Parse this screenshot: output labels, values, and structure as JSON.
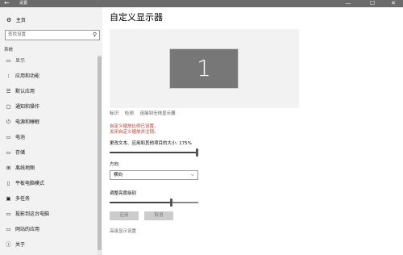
{
  "window": {
    "back_icon": "←",
    "title": "设置",
    "min_icon": "—",
    "max_icon": "☐",
    "close_icon": "✕"
  },
  "sidebar": {
    "home": {
      "icon": "⚙",
      "label": "主页"
    },
    "search": {
      "placeholder": "查找设置",
      "icon": "⚲"
    },
    "section": "系统",
    "items": [
      {
        "icon": "▭",
        "label": "显示",
        "active": true
      },
      {
        "icon": "⁝",
        "label": "应用和功能"
      },
      {
        "icon": "☰",
        "label": "默认应用"
      },
      {
        "icon": "▢",
        "label": "通知和操作"
      },
      {
        "icon": "⏻",
        "label": "电源和睡眠"
      },
      {
        "icon": "▭",
        "label": "电池"
      },
      {
        "icon": "▭",
        "label": "存储"
      },
      {
        "icon": "⊞",
        "label": "离线地图"
      },
      {
        "icon": "▯",
        "label": "平板电脑模式"
      },
      {
        "icon": "▣",
        "label": "多任务"
      },
      {
        "icon": "▭",
        "label": "投影到这台电脑"
      },
      {
        "icon": "▭",
        "label": "网站的应用"
      },
      {
        "icon": "ⓘ",
        "label": "关于"
      }
    ]
  },
  "main": {
    "title": "自定义显示器",
    "monitor_number": "1",
    "links": [
      "标识",
      "检测",
      "连接到无线显示器"
    ],
    "error_line1": "自定义缩放比例已设置。",
    "error_line2": "关闭自定义缩放并注销。",
    "scale_label": "更改文本、应用和其他项目的大小: 175%",
    "scale_percent": 100,
    "orientation_label": "方向",
    "orientation_value": "横向",
    "brightness_label": "调整亮度级别",
    "brightness_percent": 70,
    "apply_button": "应用",
    "cancel_button": "取消",
    "advanced_link": "高级显示设置"
  }
}
